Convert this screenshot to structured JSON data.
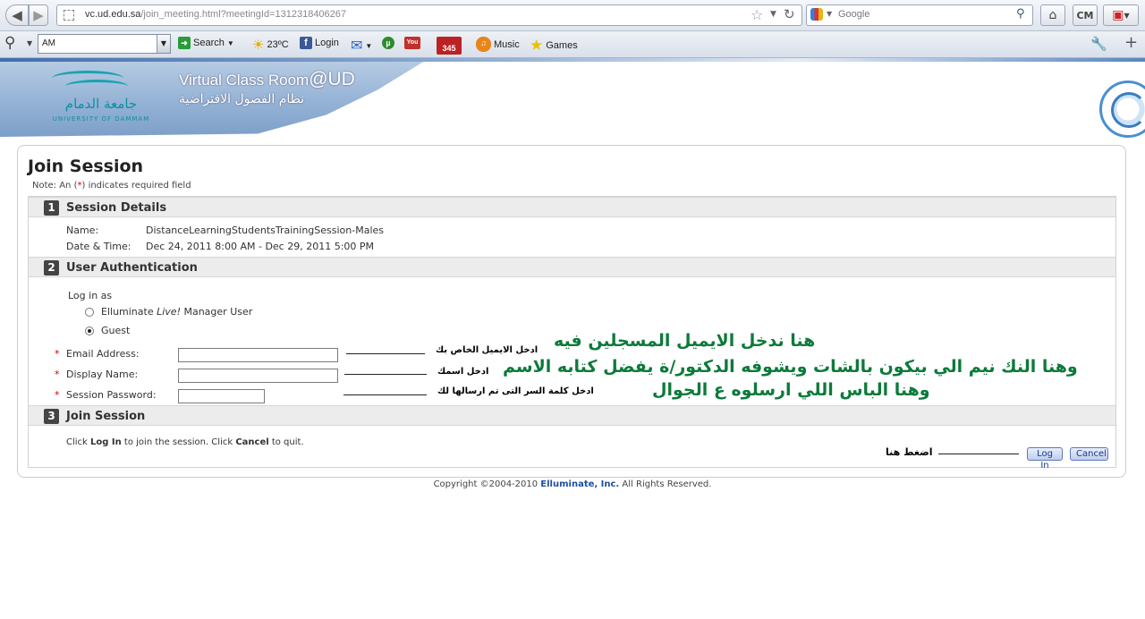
{
  "browser": {
    "url_host": "vc.ud.edu.sa",
    "url_path": "/join_meeting.html?meetingId=1312318406267",
    "search_placeholder": "Google",
    "cm_label": "CM"
  },
  "toolbar": {
    "combo_value": "AM",
    "search_label": "Search",
    "weather": "23ºC",
    "login_label": "Login",
    "badge_count": "345",
    "music_label": "Music",
    "games_label": "Games"
  },
  "banner": {
    "uni_ar": "جامعة الدمام",
    "uni_en": "UNIVERSITY OF DAMMAM",
    "vc_title": "Virtual Class Room",
    "vc_at": "@UD",
    "vc_subtitle": "نظام الفصول الافتراضية"
  },
  "page": {
    "title": "Join Session",
    "note_prefix": "Note: An (",
    "note_star": "*",
    "note_suffix": ") indicates required field",
    "copyright_prefix": "Copyright ©2004-2010 ",
    "copyright_company": "Elluminate, Inc.",
    "copyright_suffix": " All Rights Reserved."
  },
  "sections": {
    "s1_num": "1",
    "s1_label": "Session Details",
    "s2_num": "2",
    "s2_label": "User Authentication",
    "s3_num": "3",
    "s3_label": "Join Session"
  },
  "details": {
    "name_key": "Name:",
    "name_val": "DistanceLearningStudentsTrainingSession-Males",
    "date_key": "Date & Time:",
    "date_val": "Dec 24, 2011 8:00 AM - Dec 29, 2011 5:00 PM"
  },
  "auth": {
    "login_as": "Log in as",
    "opt_manager_prefix": "Elluminate ",
    "opt_manager_italic": "Live!",
    "opt_manager_suffix": " Manager User",
    "opt_guest": "Guest",
    "email_label": "Email Address:",
    "display_label": "Display Name:",
    "password_label": "Session Password:"
  },
  "annotations": {
    "email_hint": "ادخل الايميل الخاص بك",
    "display_hint": "ادخل اسمك",
    "password_hint": "ادخل كلمة السر التى تم ارسالها لك",
    "email_big": "هنا ندخل الايميل المسجلين فيه",
    "display_big": "وهنا النك نيم الي بيكون بالشات ويشوفه الدكتور/ة يفضل كتابه الاسم",
    "password_big": "وهنا الباس اللي ارسلوه ع الجوال",
    "click_here": "اضغط هنا"
  },
  "join": {
    "text_1": "Click ",
    "login_word": "Log In",
    "text_2": " to join the session. Click ",
    "cancel_word": "Cancel",
    "text_3": " to quit.",
    "login_button": "Log In",
    "cancel_button": "Cancel"
  }
}
